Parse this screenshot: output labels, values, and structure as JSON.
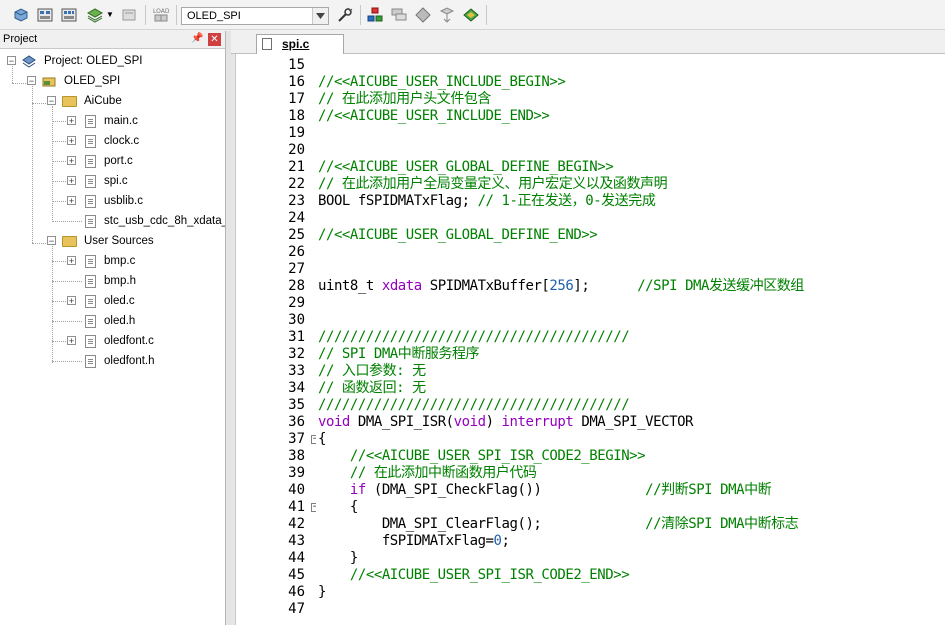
{
  "toolbar": {
    "target_name": "OLED_SPI",
    "buttons": [
      "translate-icon",
      "build-icon",
      "rebuild-icon",
      "batch-build-icon",
      "stop-build-icon",
      "download-icon",
      "target-options-icon",
      "manage-components-icon",
      "select-packs-icon",
      "pack-installer-icon",
      "software-packs-icon",
      "run-time-env-icon"
    ]
  },
  "project": {
    "header": "Project",
    "root": "Project: OLED_SPI",
    "target": "OLED_SPI",
    "groups": [
      {
        "name": "AiCube",
        "files": [
          "main.c",
          "clock.c",
          "port.c",
          "spi.c",
          "usblib.c",
          "stc_usb_cdc_8h_xdata_"
        ]
      },
      {
        "name": "User Sources",
        "files": [
          "bmp.c",
          "bmp.h",
          "oled.c",
          "oled.h",
          "oledfont.c",
          "oledfont.h"
        ]
      }
    ]
  },
  "editor": {
    "tab_label": "spi.c",
    "line_numbers": [
      "15",
      "16",
      "17",
      "18",
      "19",
      "20",
      "21",
      "22",
      "23",
      "24",
      "25",
      "26",
      "27",
      "28",
      "29",
      "30",
      "31",
      "32",
      "33",
      "34",
      "35",
      "36",
      "37",
      "38",
      "39",
      "40",
      "41",
      "42",
      "43",
      "44",
      "45",
      "46",
      "47"
    ],
    "lines": [
      [],
      [
        {
          "t": "//<<AICUBE_USER_INCLUDE_BEGIN>>",
          "c": "cmt"
        }
      ],
      [
        {
          "t": "// 在此添加用户头文件包含",
          "c": "cmt"
        }
      ],
      [
        {
          "t": "//<<AICUBE_USER_INCLUDE_END>>",
          "c": "cmt"
        }
      ],
      [],
      [],
      [
        {
          "t": "//<<AICUBE_USER_GLOBAL_DEFINE_BEGIN>>",
          "c": "cmt"
        }
      ],
      [
        {
          "t": "// 在此添加用户全局变量定义、用户宏定义以及函数声明",
          "c": "cmt"
        }
      ],
      [
        {
          "t": "BOOL fSPIDMATxFlag; ",
          "c": "plain"
        },
        {
          "t": "// 1-正在发送，0-发送完成",
          "c": "cmt"
        }
      ],
      [],
      [
        {
          "t": "//<<AICUBE_USER_GLOBAL_DEFINE_END>>",
          "c": "cmt"
        }
      ],
      [],
      [],
      [
        {
          "t": "uint8_t ",
          "c": "plain"
        },
        {
          "t": "xdata",
          "c": "kw"
        },
        {
          "t": " SPIDMATxBuffer[",
          "c": "plain"
        },
        {
          "t": "256",
          "c": "num"
        },
        {
          "t": "];      ",
          "c": "plain"
        },
        {
          "t": "//SPI DMA发送缓冲区数组",
          "c": "cmt"
        }
      ],
      [],
      [],
      [
        {
          "t": "///////////////////////////////////////",
          "c": "cmt"
        }
      ],
      [
        {
          "t": "// SPI DMA中断服务程序",
          "c": "cmt"
        }
      ],
      [
        {
          "t": "// 入口参数: 无",
          "c": "cmt"
        }
      ],
      [
        {
          "t": "// 函数返回: 无",
          "c": "cmt"
        }
      ],
      [
        {
          "t": "///////////////////////////////////////",
          "c": "cmt"
        }
      ],
      [
        {
          "t": "void",
          "c": "kw"
        },
        {
          "t": " DMA_SPI_ISR(",
          "c": "plain"
        },
        {
          "t": "void",
          "c": "kw"
        },
        {
          "t": ") ",
          "c": "plain"
        },
        {
          "t": "interrupt",
          "c": "kw"
        },
        {
          "t": " DMA_SPI_VECTOR",
          "c": "plain"
        }
      ],
      [
        {
          "t": "{",
          "c": "plain"
        }
      ],
      [
        {
          "t": "    //<<AICUBE_USER_SPI_ISR_CODE2_BEGIN>>",
          "c": "cmt"
        }
      ],
      [
        {
          "t": "    // 在此添加中断函数用户代码",
          "c": "cmt"
        }
      ],
      [
        {
          "t": "    ",
          "c": "plain"
        },
        {
          "t": "if",
          "c": "kw"
        },
        {
          "t": " (DMA_SPI_CheckFlag())             ",
          "c": "plain"
        },
        {
          "t": "//判断SPI DMA中断",
          "c": "cmt"
        }
      ],
      [
        {
          "t": "    {",
          "c": "plain"
        }
      ],
      [
        {
          "t": "        DMA_SPI_ClearFlag();             ",
          "c": "plain"
        },
        {
          "t": "//清除SPI DMA中断标志",
          "c": "cmt"
        }
      ],
      [
        {
          "t": "        fSPIDMATxFlag=",
          "c": "plain"
        },
        {
          "t": "0",
          "c": "num"
        },
        {
          "t": ";",
          "c": "plain"
        }
      ],
      [
        {
          "t": "    }",
          "c": "plain"
        }
      ],
      [
        {
          "t": "    //<<AICUBE_USER_SPI_ISR_CODE2_END>>",
          "c": "cmt"
        }
      ],
      [
        {
          "t": "}",
          "c": "plain"
        }
      ],
      []
    ]
  }
}
